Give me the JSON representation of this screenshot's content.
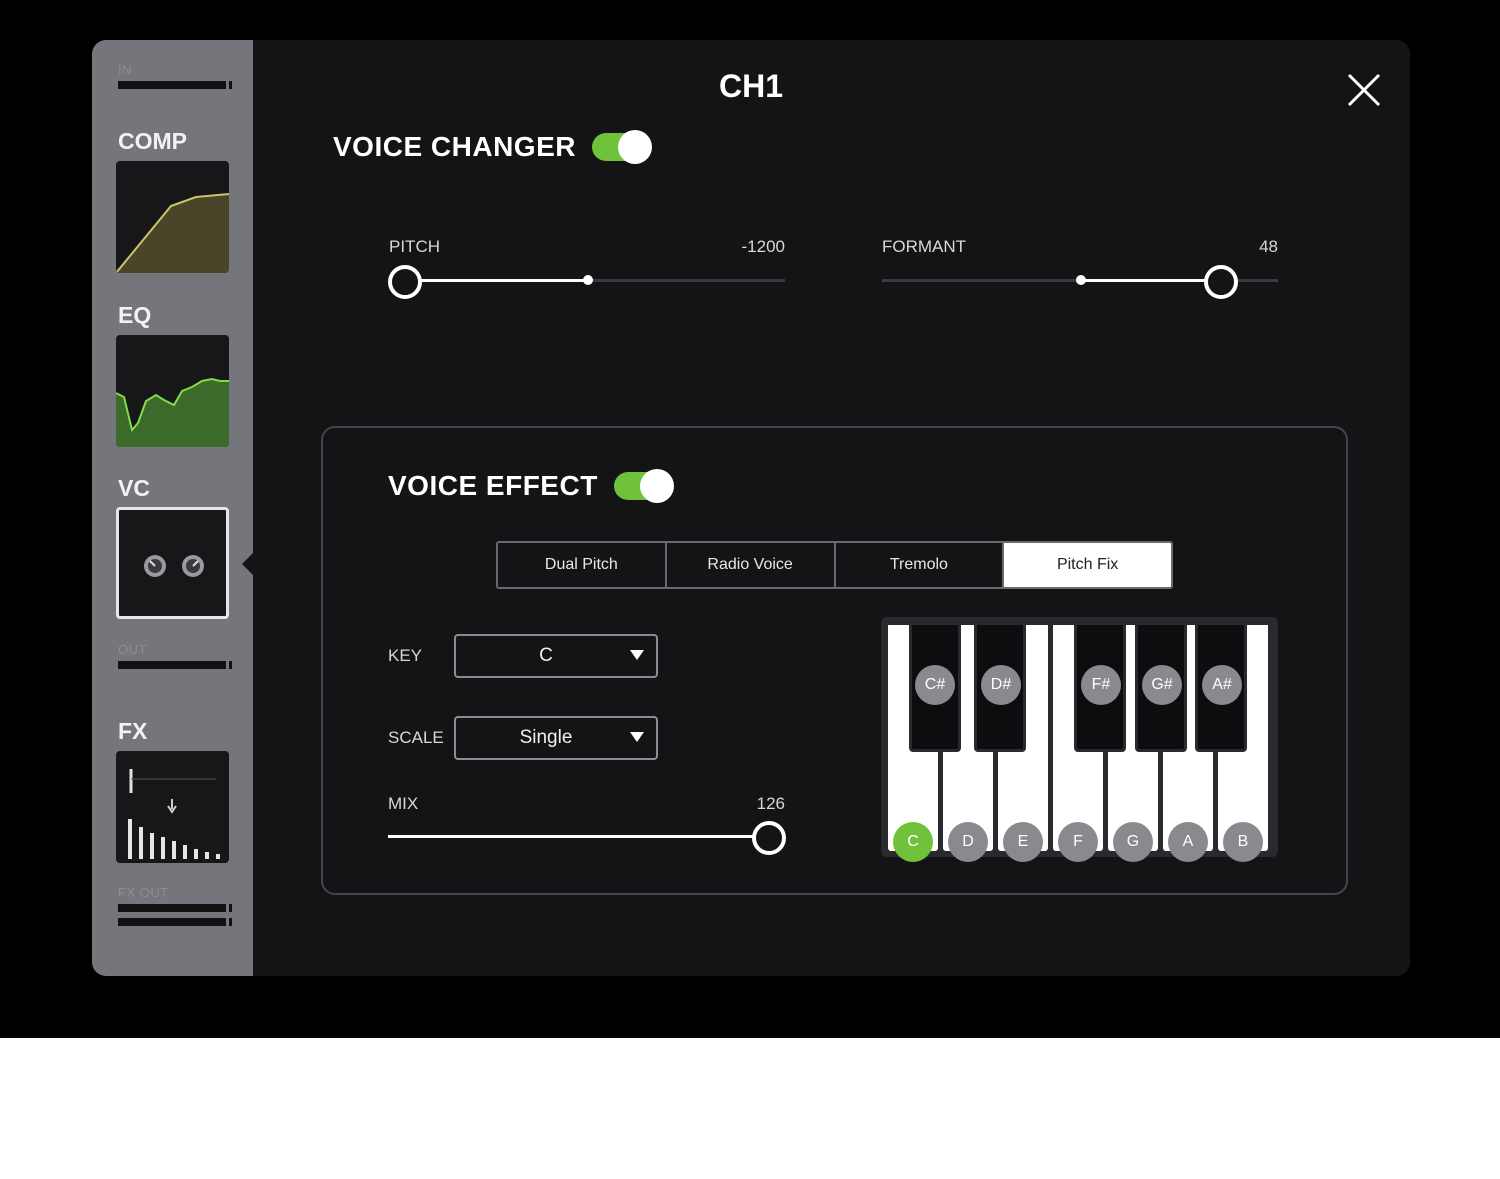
{
  "window": {
    "title": "CH1"
  },
  "sidebar": {
    "in_label": "IN",
    "comp_label": "COMP",
    "eq_label": "EQ",
    "vc_label": "VC",
    "out_label": "OUT",
    "fx_label": "FX",
    "fx_out_label": "FX OUT"
  },
  "voice_changer": {
    "title": "VOICE CHANGER",
    "enabled": true,
    "pitch": {
      "label": "PITCH",
      "value": "-1200"
    },
    "formant": {
      "label": "FORMANT",
      "value": "48"
    }
  },
  "voice_effect": {
    "title": "VOICE EFFECT",
    "enabled": true,
    "tabs": [
      {
        "label": "Dual Pitch",
        "active": false
      },
      {
        "label": "Radio Voice",
        "active": false
      },
      {
        "label": "Tremolo",
        "active": false
      },
      {
        "label": "Pitch Fix",
        "active": true
      }
    ],
    "key": {
      "label": "KEY",
      "value": "C"
    },
    "scale": {
      "label": "SCALE",
      "value": "Single"
    },
    "mix": {
      "label": "MIX",
      "value": "126"
    },
    "keyboard": {
      "white_keys": [
        "C",
        "D",
        "E",
        "F",
        "G",
        "A",
        "B"
      ],
      "black_keys": [
        "C#",
        "D#",
        "F#",
        "G#",
        "A#"
      ],
      "selected": "C"
    }
  },
  "colors": {
    "accent": "#6fc23a",
    "background": "#141416",
    "sidebar": "#75767b"
  }
}
